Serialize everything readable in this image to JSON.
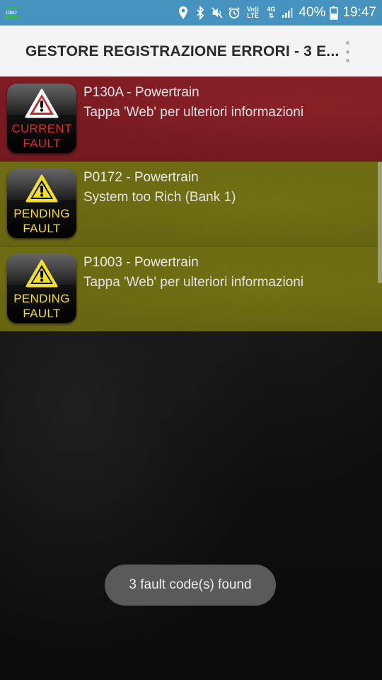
{
  "status_bar": {
    "app_icon": "obd-icon",
    "app_icon_text": "OBD",
    "icons": [
      "location-icon",
      "bluetooth-icon",
      "mute-icon",
      "alarm-icon",
      "volte-icon",
      "4g-lte-icon",
      "signal-icon"
    ],
    "volte_text_top": "Vo))",
    "volte_text_bottom": "LTE",
    "network_type": "4G",
    "battery": "40%",
    "time": "19:47"
  },
  "app_bar": {
    "title": "GESTORE REGISTRAZIONE ERRORI - 3 E...",
    "menu_icon": "overflow-menu-icon"
  },
  "faults": [
    {
      "status": "current",
      "badge_line1": "CURRENT",
      "badge_line2": "FAULT",
      "code": "P130A - Powertrain",
      "description": "Tappa 'Web' per ulteriori informazioni",
      "colors": {
        "row": "#7a1b21",
        "badge_text": "#e8242a",
        "triangle": "#d81f26"
      }
    },
    {
      "status": "pending",
      "badge_line1": "PENDING",
      "badge_line2": "FAULT",
      "code": "P0172 - Powertrain",
      "description": "System too Rich (Bank 1)",
      "colors": {
        "row": "#6b6912",
        "badge_text": "#f2e11c",
        "triangle": "#f2e11c"
      }
    },
    {
      "status": "pending",
      "badge_line1": "PENDING",
      "badge_line2": "FAULT",
      "code": "P1003 - Powertrain",
      "description": "Tappa 'Web' per ulteriori informazioni",
      "colors": {
        "row": "#6b6912",
        "badge_text": "#f2e11c",
        "triangle": "#f2e11c"
      }
    }
  ],
  "toast": {
    "message": "3 fault code(s) found"
  },
  "colors": {
    "status_bar": "#4593be",
    "app_bar": "#f4f4f4",
    "background": "#0c0c0c",
    "toast": "#5a5a5a"
  }
}
